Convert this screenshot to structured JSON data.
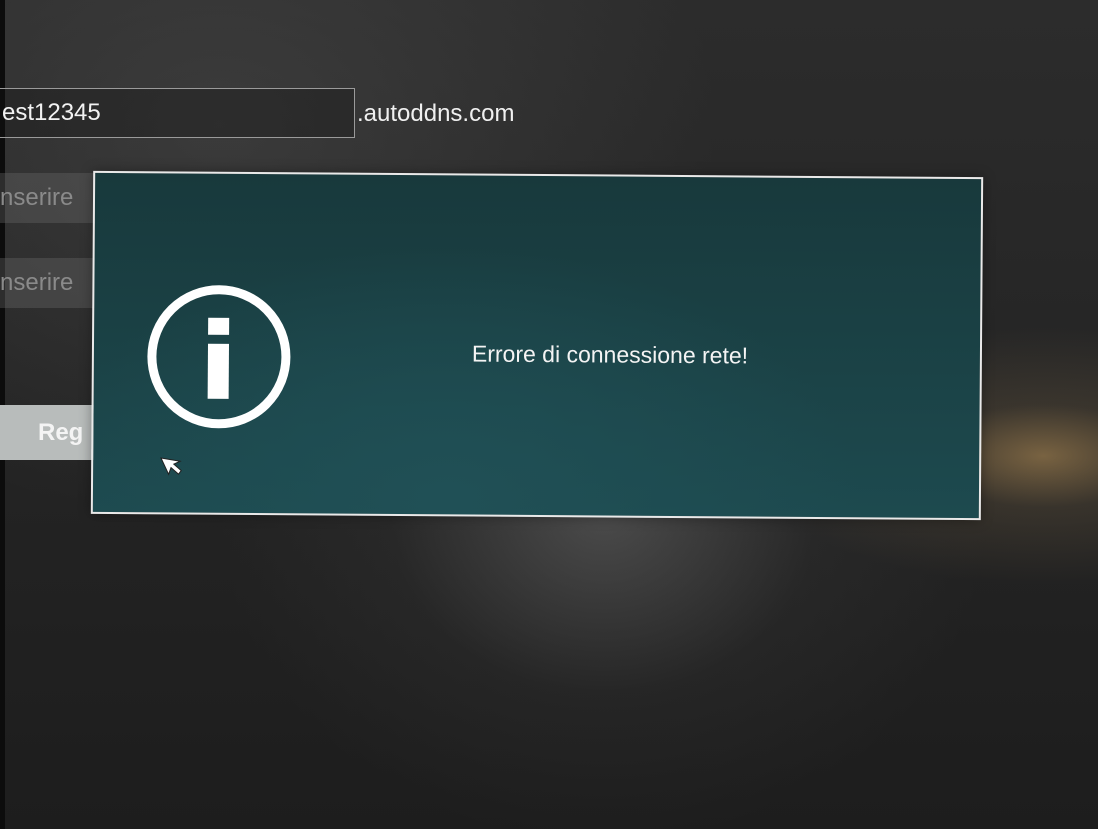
{
  "form": {
    "domain_value": "est12345",
    "domain_suffix": ".autoddns.com",
    "field_two_placeholder": "nserire",
    "field_three_placeholder": "nserire",
    "register_label": "Reg"
  },
  "dialog": {
    "icon": "info-icon",
    "message": "Errore di connessione rete!"
  },
  "colors": {
    "dialog_background": "#1b4347",
    "dialog_border": "#e9e9e9",
    "text": "#f4f4f4"
  }
}
